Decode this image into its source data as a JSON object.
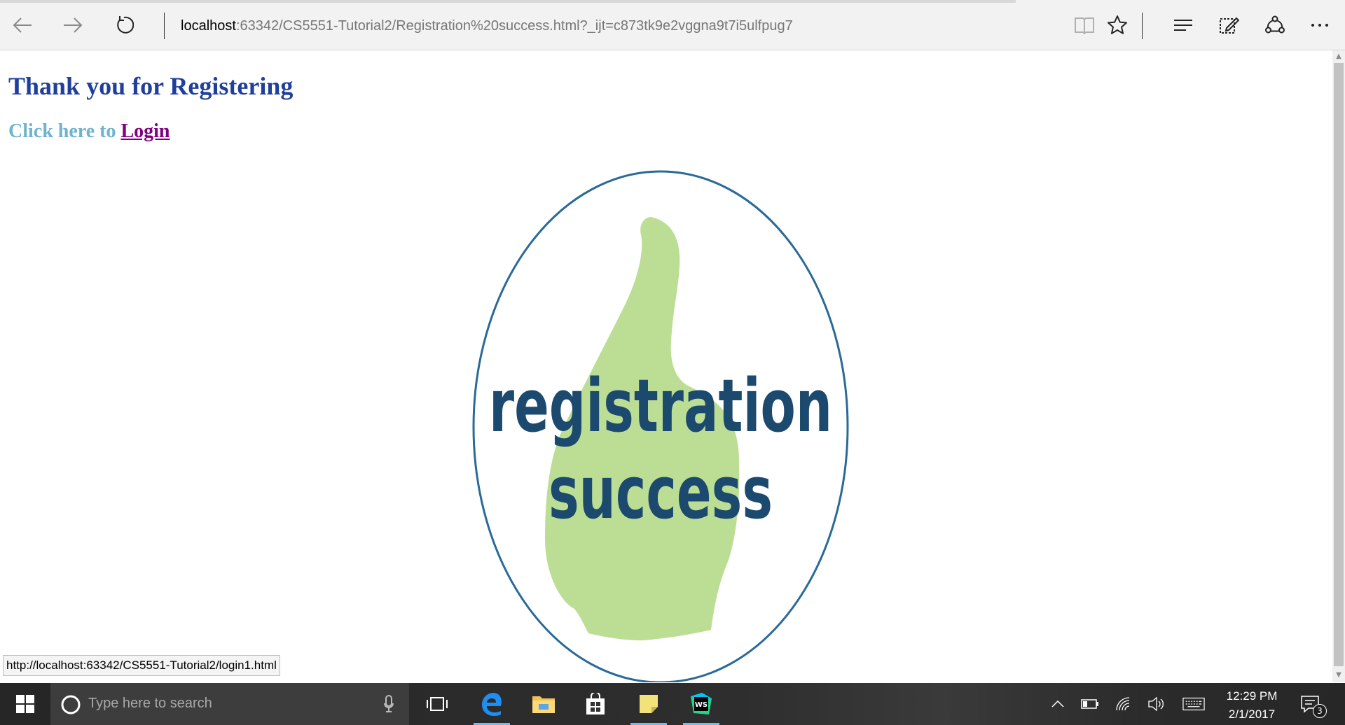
{
  "browser": {
    "address_host": "localhost",
    "address_rest": ":63342/CS5551-Tutorial2/Registration%20success.html?_ijt=c873tk9e2vggna9t7i5ulfpug7"
  },
  "page": {
    "title": "Thank you for Registering",
    "login_prefix": "Click here to ",
    "login_link": "Login",
    "badge_line1": "registration",
    "badge_line2": "success"
  },
  "status": {
    "hover_url": "http://localhost:63342/CS5551-Tutorial2/login1.html"
  },
  "taskbar": {
    "search_placeholder": "Type here to search",
    "time": "12:29 PM",
    "date": "2/1/2017",
    "notification_count": "3"
  },
  "colors": {
    "title": "#1f3f9a",
    "login_prefix": "#6fb3cf",
    "login_link": "#800080",
    "badge_text": "#1c4a6e",
    "badge_thumb": "#bcde94",
    "badge_ring": "#2a6a98"
  }
}
